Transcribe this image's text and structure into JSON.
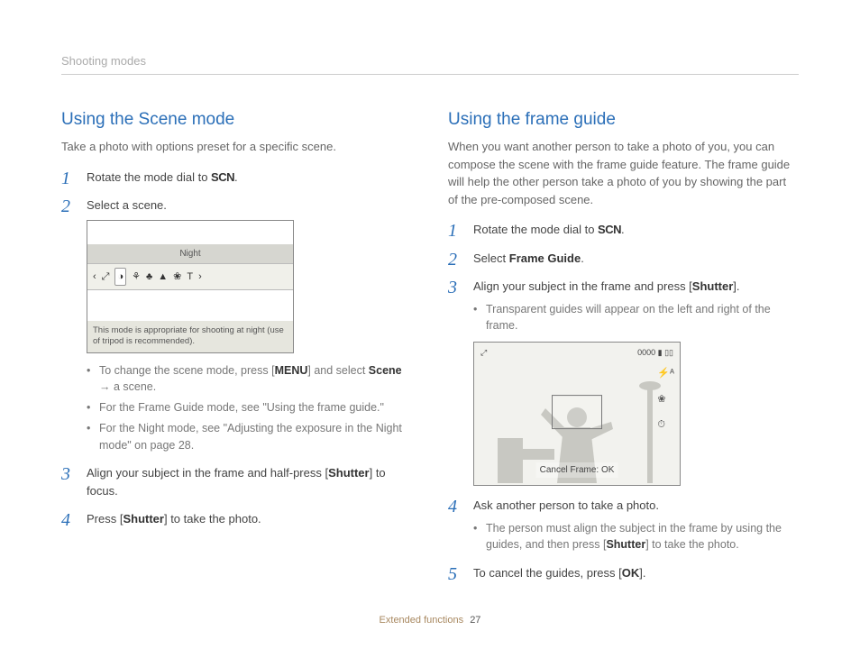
{
  "header": {
    "breadcrumb": "Shooting modes"
  },
  "left": {
    "title": "Using the Scene mode",
    "intro": "Take a photo with options preset for a specific scene.",
    "step1_a": "Rotate the mode dial to ",
    "step1_b": ".",
    "step2": "Select a scene.",
    "scene_box": {
      "label": "Night",
      "desc": "This mode is appropriate for shooting at night (use of tripod is recommended).",
      "icons": {
        "left_arrow": "‹",
        "i1": "⤢",
        "i2_sel": "◑",
        "i3": "⚘",
        "i4": "♣",
        "i5": "▲",
        "i6": "❀",
        "i7": "T",
        "right_arrow": "›"
      }
    },
    "sub_bullets": {
      "b1_a": "To change the scene mode, press [",
      "b1_menu": "MENU",
      "b1_b": "] and select ",
      "b1_scene": "Scene",
      "b1_c": " → a scene.",
      "b2": "For the Frame Guide mode, see \"Using the frame guide.\"",
      "b3": "For the Night mode, see \"Adjusting the exposure in the Night mode\" on page 28."
    },
    "step3_a": "Align your subject in the frame and half-press [",
    "step3_sh": "Shutter",
    "step3_b": "] to focus.",
    "step4_a": "Press [",
    "step4_sh": "Shutter",
    "step4_b": "] to take the photo.",
    "scn_label": "SCN"
  },
  "right": {
    "title": "Using the frame guide",
    "intro": "When you want another person to take a photo of you, you can compose the scene with the frame guide feature. The frame guide will help the other person take a photo of you by showing the part of the pre-composed scene.",
    "step1_a": "Rotate the mode dial to ",
    "step1_b": ".",
    "step2_a": "Select ",
    "step2_fg": "Frame Guide",
    "step2_b": ".",
    "step3_a": "Align your subject in the frame and press [",
    "step3_sh": "Shutter",
    "step3_b": "].",
    "step3_bullet": "Transparent guides will appear on the left and right of the frame.",
    "frame_box": {
      "top_left_icon": "⤢",
      "top_right": "0000 ▮ ▯▯",
      "right_icons": {
        "r1": "⚡ᴬ",
        "r2": "❀",
        "r3": "⏱"
      },
      "cancel": "Cancel Frame: OK"
    },
    "step4": "Ask another person to take a photo.",
    "step4_bullet_a": "The person must align the subject in the frame by using the guides, and then press [",
    "step4_bullet_sh": "Shutter",
    "step4_bullet_b": "] to take the photo.",
    "step5_a": "To cancel the guides, press [",
    "step5_ok": "OK",
    "step5_b": "].",
    "scn_label": "SCN"
  },
  "footer": {
    "section": "Extended functions",
    "page": "27"
  }
}
